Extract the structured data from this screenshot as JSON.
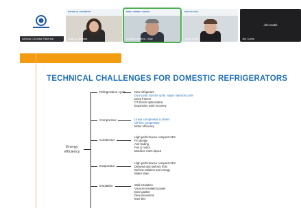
{
  "participants": [
    {
      "name": "Alessia Cordoba Pallerina"
    },
    {
      "name": "Scali Al-Ansarat",
      "banner": "DAVIDE AL-SHAMMARI"
    },
    {
      "name": "Luciano Andrea - Italy",
      "banner": "PROF. ANDREA AIESSO"
    },
    {
      "name": "Tanja Kluge",
      "banner": "KEILA KLUGE"
    },
    {
      "name": "Jim Curtis"
    }
  ],
  "slide": {
    "title": "TECHNICAL CHALLENGES FOR DOMESTIC REFRIGERATORS",
    "root": "Energy efficiency",
    "branches": [
      {
        "label": "Refrigeration cycle",
        "items": [
          {
            "text": "New refrigerant",
            "blue": false
          },
          {
            "text": "Dual cycle, Ejector cycle, Vapor injection cycle",
            "blue": true
          },
          {
            "text": "Deep freezer",
            "blue": false
          },
          {
            "text": "CT-SUHX optimization",
            "blue": false
          },
          {
            "text": "Expansion work recovery",
            "blue": false
          }
        ]
      },
      {
        "label": "Compressor",
        "items": [
          {
            "text": "Linear compressor & others",
            "blue": true
          },
          {
            "text": "Oil-free compressor",
            "blue": true
          },
          {
            "text": "Motor efficiency",
            "blue": false
          }
        ]
      },
      {
        "label": "Condenser",
        "items": [
          {
            "text": "High performance compact HEX",
            "blue": false
          },
          {
            "text": "Fin design",
            "blue": false
          },
          {
            "text": "Anti-fouling",
            "blue": false
          },
          {
            "text": "Fan & motor",
            "blue": false
          },
          {
            "text": "Machine room layout",
            "blue": false
          }
        ]
      },
      {
        "label": "Evaporator",
        "items": [
          {
            "text": "High performance compact HEX",
            "blue": false
          },
          {
            "text": "Delayed and uniform frost",
            "blue": false
          },
          {
            "text": "Defrost initiation and energy",
            "blue": false
          },
          {
            "text": "Water drain",
            "blue": false
          }
        ]
      },
      {
        "label": "Insulation",
        "items": [
          {
            "text": "Wall insulation",
            "blue": false
          },
          {
            "text": "Vacuum insulation panel",
            "blue": false
          },
          {
            "text": "Door gasket",
            "blue": false
          },
          {
            "text": "Dew prevention",
            "blue": false
          },
          {
            "text": "Inter-ties",
            "blue": false
          }
        ]
      }
    ]
  }
}
